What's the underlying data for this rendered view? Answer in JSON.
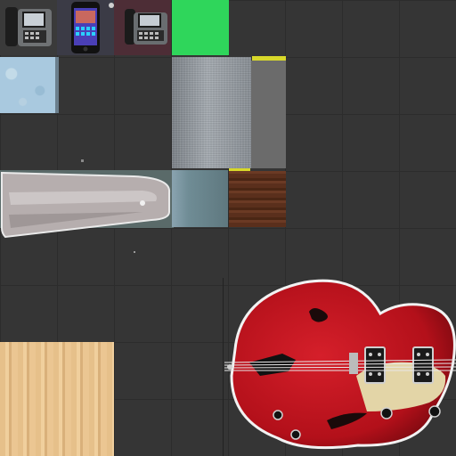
{
  "atlas": {
    "background": "#353535",
    "grid_color": "#2c2c2c",
    "tiles": [
      {
        "id": "desk-phone-gray",
        "icon": "desk-phone-icon"
      },
      {
        "id": "smartphone",
        "icon": "smartphone-icon"
      },
      {
        "id": "desk-phone-dark",
        "icon": "desk-phone-icon"
      },
      {
        "id": "green-swatch",
        "color": "#2fd65b"
      },
      {
        "id": "light-blue-texture",
        "color": "#a9c9df"
      },
      {
        "id": "noise-texture",
        "color": "#8a8f95"
      },
      {
        "id": "gray-strip",
        "color": "#6b6b6b"
      },
      {
        "id": "yellow-strip",
        "color": "#d8d82a"
      },
      {
        "id": "metal-blade-texture",
        "color": "#b6aeae"
      },
      {
        "id": "blue-gray-texture",
        "color": "#6f8c95"
      },
      {
        "id": "dark-wood-texture",
        "color": "#5a2f1c"
      },
      {
        "id": "light-wood-texture",
        "color": "#e6c08a"
      },
      {
        "id": "guitar-body",
        "icon": "guitar-icon",
        "color": "#b3101a"
      }
    ]
  }
}
